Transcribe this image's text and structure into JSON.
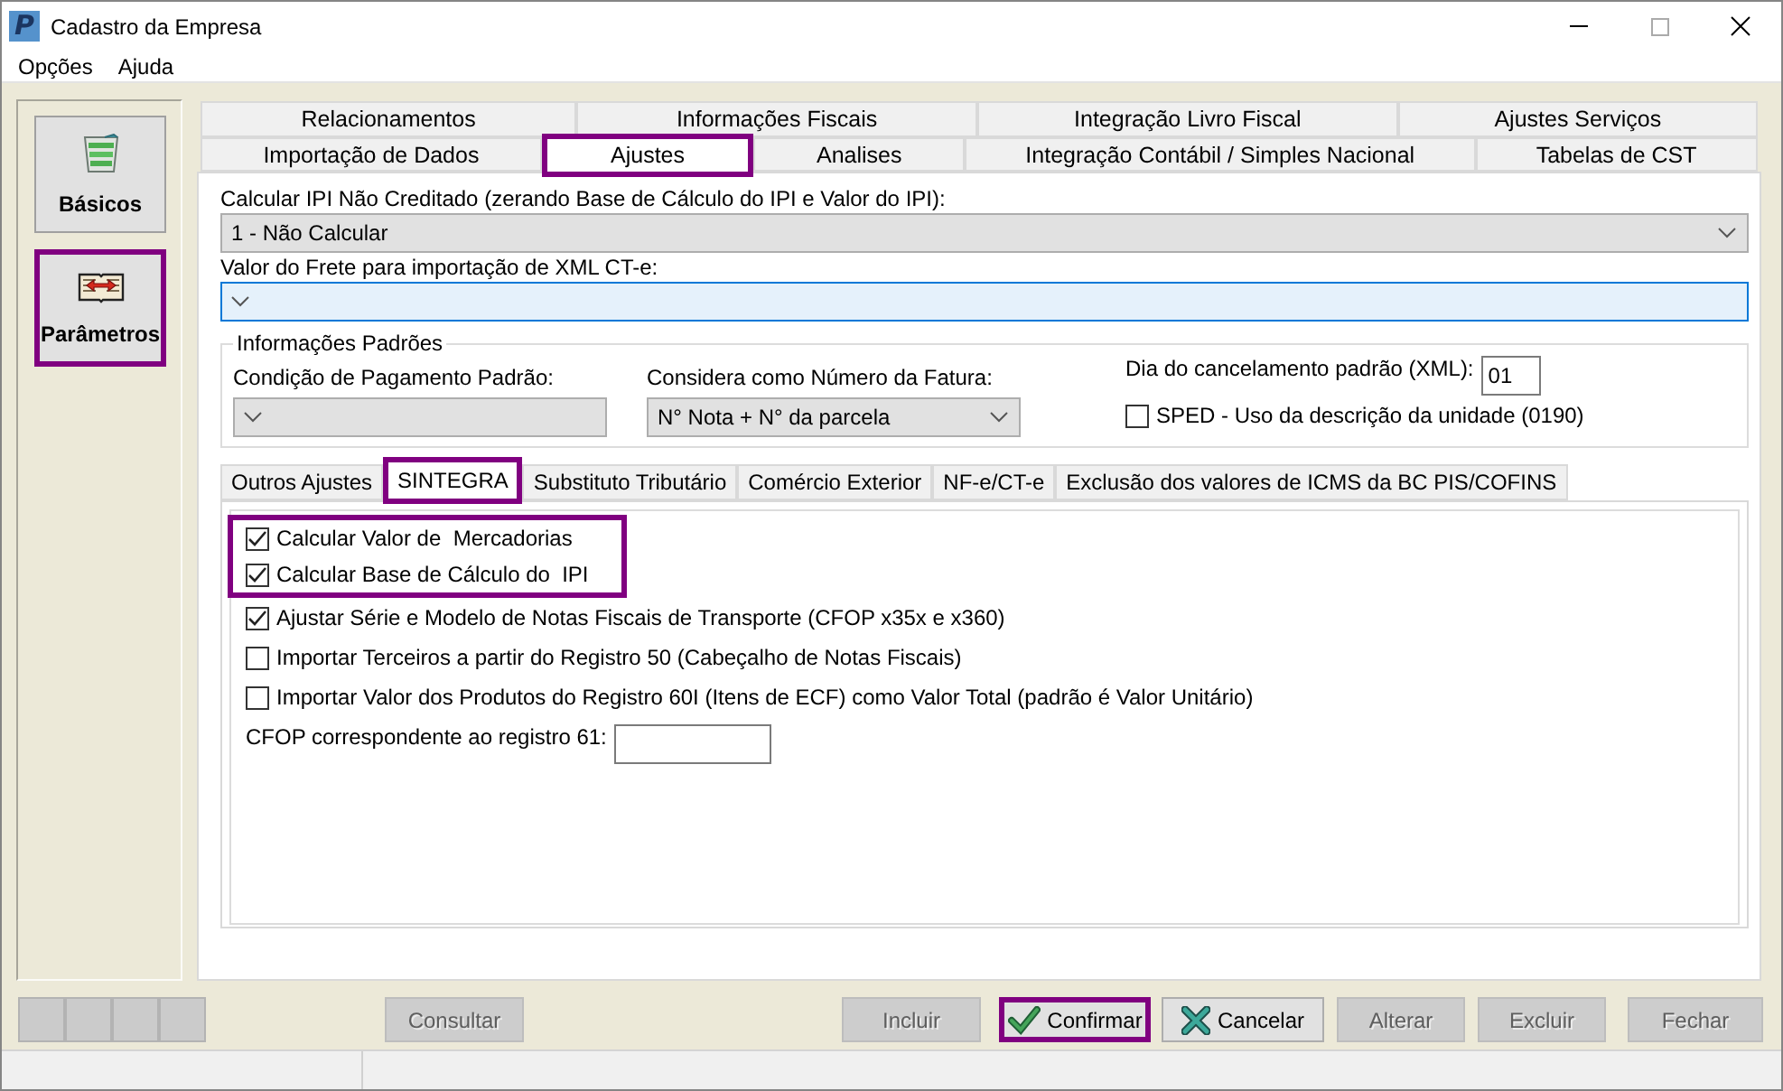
{
  "window": {
    "logo": "P",
    "title": "Cadastro da Empresa"
  },
  "menu": [
    {
      "label": "Opções"
    },
    {
      "label": "Ajuda"
    }
  ],
  "sidebar": {
    "items": [
      {
        "label": "Básicos",
        "kind": "basics",
        "highlighted": false
      },
      {
        "label": "Parâmetros",
        "kind": "parameters",
        "highlighted": true
      }
    ]
  },
  "tab_rows": [
    {
      "tabs": [
        {
          "label": "Relacionamentos",
          "selected": false,
          "highlighted": false
        },
        {
          "label": "Informações Fiscais",
          "selected": false,
          "highlighted": false
        },
        {
          "label": "Integração Livro Fiscal",
          "selected": false,
          "highlighted": false
        },
        {
          "label": "Ajustes Serviços",
          "selected": false,
          "highlighted": false
        }
      ]
    },
    {
      "tabs": [
        {
          "label": "Importação de Dados",
          "selected": false,
          "highlighted": false
        },
        {
          "label": "Ajustes",
          "selected": true,
          "highlighted": true
        },
        {
          "label": "Analises",
          "selected": false,
          "highlighted": false
        },
        {
          "label": "Integração Contábil / Simples Nacional",
          "selected": false,
          "highlighted": false
        },
        {
          "label": "Tabelas de CST",
          "selected": false,
          "highlighted": false
        }
      ]
    }
  ],
  "ajustes": {
    "ipi_nao_creditado": {
      "label": "Calcular IPI Não Creditado (zerando Base de Cálculo do IPI e Valor do IPI):",
      "value": "1 - Não Calcular",
      "focused": false
    },
    "valor_frete": {
      "label": "Valor do Frete para importação de XML CT-e:",
      "focused": true
    },
    "informacoes_padroes": {
      "title": "Informações Padrões",
      "condicao_pagamento": {
        "label": "Condição de Pagamento Padrão:"
      },
      "numero_fatura": {
        "label": "Considera como Número da Fatura:",
        "value": "N° Nota + N° da parcela"
      },
      "dia_cancelamento": {
        "label": "Dia do cancelamento padrão (XML):",
        "value": "01"
      },
      "sped_unidade": {
        "label": "SPED - Uso da descrição da unidade (0190)",
        "checked": false
      }
    },
    "subtabs": [
      {
        "label": "Outros Ajustes",
        "selected": false,
        "highlighted": false
      },
      {
        "label": "SINTEGRA",
        "selected": true,
        "highlighted": true
      },
      {
        "label": "Substituto Tributário",
        "selected": false,
        "highlighted": false
      },
      {
        "label": "Comércio Exterior",
        "selected": false,
        "highlighted": false
      },
      {
        "label": "NF-e/CT-e",
        "selected": false,
        "highlighted": false
      },
      {
        "label": "Exclusão dos valores de ICMS da BC PIS/COFINS",
        "selected": false,
        "highlighted": false
      }
    ],
    "sintegra": {
      "options": [
        {
          "label": "Calcular Valor de  Mercadorias",
          "checked": true,
          "highlighted": true
        },
        {
          "label": "Calcular Base de Cálculo do  IPI",
          "checked": true,
          "highlighted": true
        },
        {
          "label": "Ajustar Série e Modelo de Notas Fiscais de Transporte (CFOP x35x e x360)",
          "checked": true,
          "highlighted": false
        },
        {
          "label": "Importar Terceiros a partir do Registro 50 (Cabeçalho de Notas Fiscais)",
          "checked": false,
          "highlighted": false
        },
        {
          "label": "Importar Valor dos Produtos do Registro 60I (Itens de ECF) como Valor Total (padrão é Valor Unitário)",
          "checked": false,
          "highlighted": false
        }
      ],
      "cfop_61": {
        "label": "CFOP correspondente ao registro 61:"
      }
    }
  },
  "buttons": {
    "record": [
      {
        "disabled": true
      },
      {
        "disabled": true
      },
      {
        "disabled": true
      },
      {
        "disabled": true
      }
    ],
    "left": [
      {
        "label": "Consultar",
        "disabled": true,
        "highlighted": false
      }
    ],
    "right": [
      {
        "label": "Incluir",
        "kind": "plain",
        "disabled": true,
        "highlighted": false
      },
      {
        "label": "Confirmar",
        "kind": "confirm",
        "disabled": false,
        "highlighted": true
      },
      {
        "label": "Cancelar",
        "kind": "cancel",
        "disabled": false,
        "highlighted": false
      },
      {
        "label": "Alterar",
        "kind": "plain",
        "disabled": true,
        "highlighted": false
      },
      {
        "label": "Excluir",
        "kind": "plain",
        "disabled": true,
        "highlighted": false
      },
      {
        "label": "Fechar",
        "kind": "plain",
        "disabled": true,
        "highlighted": false
      }
    ]
  }
}
